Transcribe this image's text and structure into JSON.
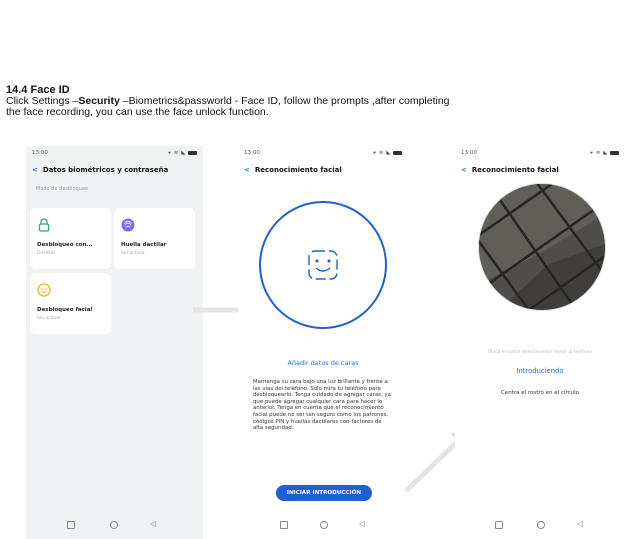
{
  "section": {
    "number": "14.4",
    "title": "Face ID"
  },
  "instructions": {
    "line1_prefix": "Click Settings –",
    "line1_bold": "Security",
    "line1_suffix": " –Biometrics&passworld   - Face ID, follow the prompts ,after completing",
    "line2": "the face recording, you can use the face unlock function."
  },
  "screen1": {
    "time": "13:00",
    "status_icons": "⚹ ≋ ◣",
    "title": "Datos biométricos y contraseña",
    "section_label": "Modo de desbloqueo",
    "cards": [
      {
        "title": "Desbloqueo con...",
        "sub": "Deslizar",
        "icon": "lock-icon"
      },
      {
        "title": "Huella dactilar",
        "sub": "Sin activar",
        "icon": "fingerprint-icon"
      },
      {
        "title": "Desbloqueo facial",
        "sub": "Sin activar",
        "icon": "face-icon"
      }
    ]
  },
  "screen2": {
    "time": "13:00",
    "status_icons": "⚹ ≋ ◣",
    "title": "Reconocimiento facial",
    "add_label": "Añadir datos de caras",
    "paragraph": "Mantenga su cara bajo una luz brillante y frente a las vías del teléfono. Solo mira tu teléfono para desbloquearlo. Tenga cuidado de agregar caras, ya que puede agregar cualquier cara para hacer lo anterior. Tenga en cuenta que el reconocimiento facial puede no ser tan seguro como los patrones, códigos PIN y huellas dactilares con factores de alta seguridad.",
    "button": "INICIAR INTRODUCCIÓN"
  },
  "screen3": {
    "time": "13:00",
    "status_icons": "⚹ ≋ ◣",
    "title": "Reconocimiento facial",
    "hint": "Ubica el rostro directamente frente al teléfono",
    "status": "Introduciendo",
    "note": "Centra el rostro en el círculo"
  },
  "colors": {
    "accent": "#1a73e8",
    "button": "#1f5ed6",
    "screen_bg": "#f1f2f4"
  }
}
